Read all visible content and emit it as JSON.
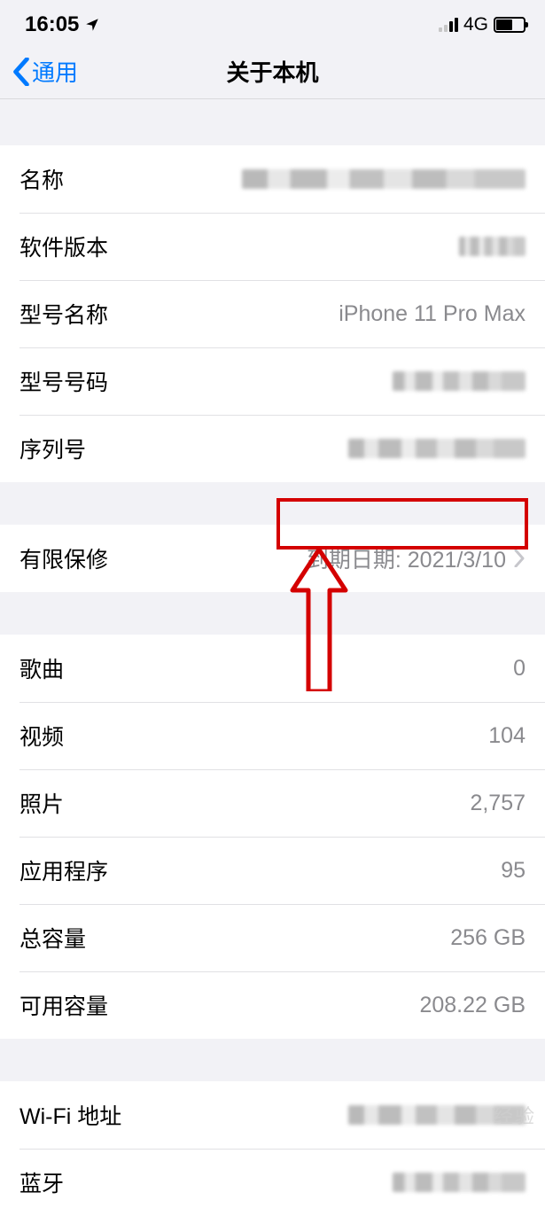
{
  "status": {
    "time": "16:05",
    "network": "4G"
  },
  "nav": {
    "back_label": "通用",
    "title": "关于本机"
  },
  "group1": {
    "name_label": "名称",
    "sw_label": "软件版本",
    "model_name_label": "型号名称",
    "model_name_value": "iPhone 11 Pro Max",
    "model_number_label": "型号号码",
    "serial_label": "序列号"
  },
  "warranty": {
    "label": "有限保修",
    "value": "到期日期: 2021/3/10"
  },
  "stats": {
    "songs_label": "歌曲",
    "songs_value": "0",
    "videos_label": "视频",
    "videos_value": "104",
    "photos_label": "照片",
    "photos_value": "2,757",
    "apps_label": "应用程序",
    "apps_value": "95",
    "capacity_label": "总容量",
    "capacity_value": "256 GB",
    "available_label": "可用容量",
    "available_value": "208.22 GB"
  },
  "addresses": {
    "wifi_label": "Wi-Fi 地址",
    "bt_label": "蓝牙"
  },
  "watermark": "经验"
}
